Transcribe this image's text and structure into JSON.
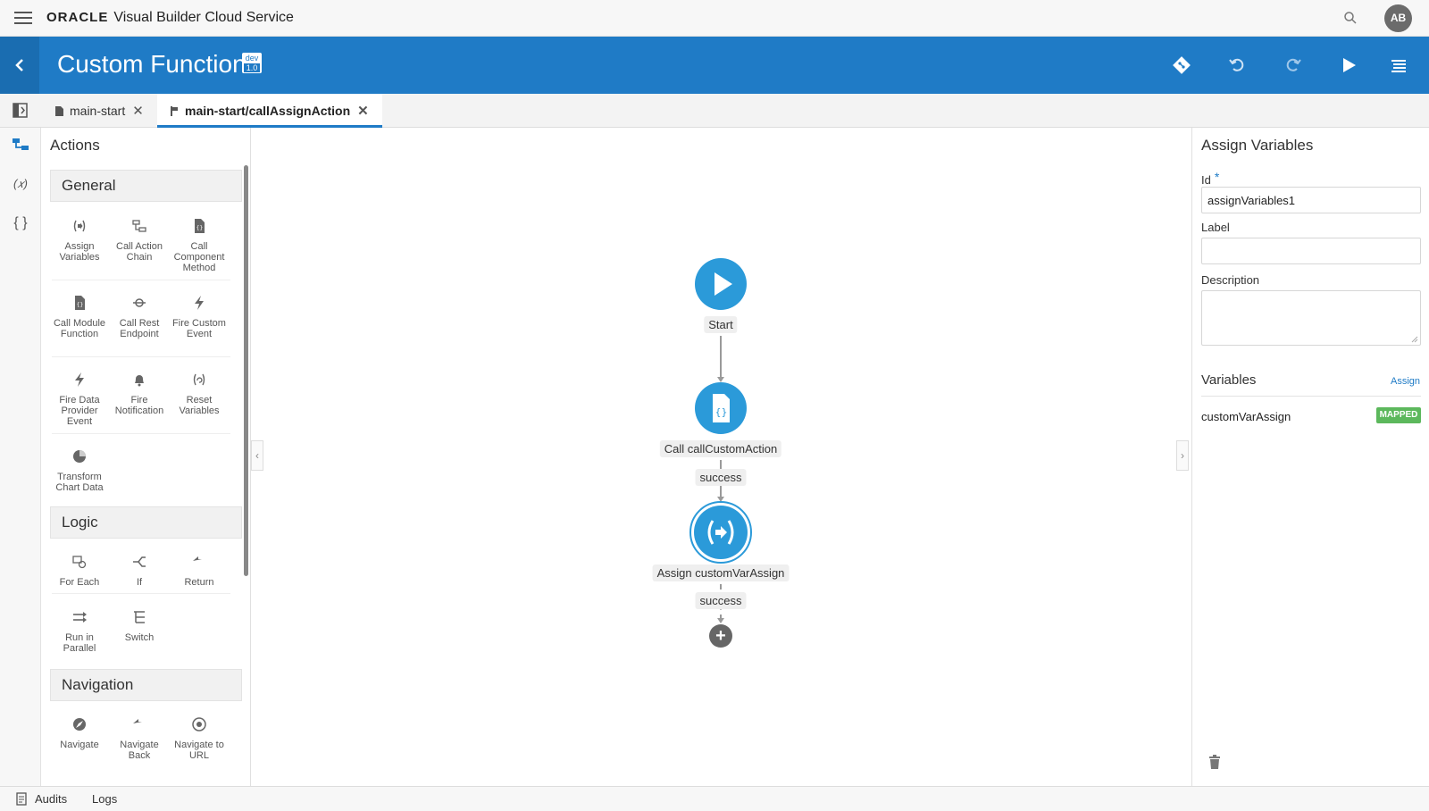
{
  "topbar": {
    "brand_oracle": "ORACLE",
    "brand_product": "Visual Builder Cloud Service",
    "avatar_initials": "AB"
  },
  "header": {
    "title": "Custom Function",
    "env_label": "dev",
    "env_version": "1.0"
  },
  "tabs": [
    {
      "label": "main-start"
    },
    {
      "label": "main-start/callAssignAction"
    }
  ],
  "actions_panel": {
    "title": "Actions",
    "sections": {
      "general": {
        "label": "General",
        "items": [
          "Assign Variables",
          "Call Action Chain",
          "Call Component Method",
          "Call Module Function",
          "Call Rest Endpoint",
          "Fire Custom Event",
          "Fire Data Provider Event",
          "Fire Notification",
          "Reset Variables",
          "Transform Chart Data"
        ]
      },
      "logic": {
        "label": "Logic",
        "items": [
          "For Each",
          "If",
          "Return",
          "Run in Parallel",
          "Switch"
        ]
      },
      "navigation": {
        "label": "Navigation",
        "items": [
          "Navigate",
          "Navigate Back",
          "Navigate to URL"
        ]
      }
    }
  },
  "flow": {
    "start_label": "Start",
    "call_label": "Call callCustomAction",
    "success1": "success",
    "assign_label": "Assign customVarAssign",
    "success2": "success"
  },
  "props": {
    "title": "Assign Variables",
    "id_label": "Id",
    "required_mark": "*",
    "id_value": "assignVariables1",
    "label_label": "Label",
    "label_value": "",
    "description_label": "Description",
    "variables_title": "Variables",
    "assign_link": "Assign",
    "variable_name": "customVarAssign",
    "variable_status": "MAPPED"
  },
  "bottombar": {
    "audits": "Audits",
    "logs": "Logs"
  },
  "colors": {
    "header_blue": "#1f7bc6",
    "node_blue": "#2b9ad9",
    "mapped_green": "#5cb85c"
  }
}
